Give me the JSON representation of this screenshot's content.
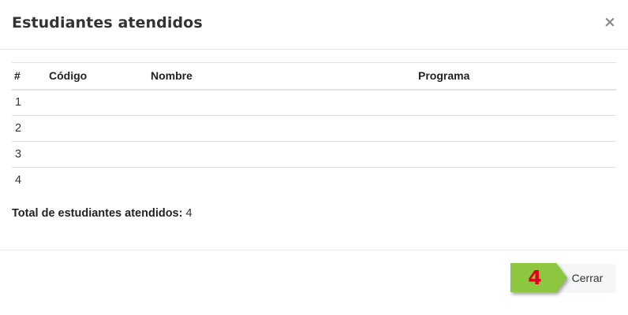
{
  "modal": {
    "title": "Estudiantes atendidos",
    "close_symbol": "×"
  },
  "table": {
    "headers": {
      "num": "#",
      "code": "Código",
      "name": "Nombre",
      "program": "Programa"
    },
    "rows": [
      {
        "num": "1",
        "code": "",
        "name": "",
        "program": ""
      },
      {
        "num": "2",
        "code": "",
        "name": "",
        "program": ""
      },
      {
        "num": "3",
        "code": "",
        "name": "",
        "program": ""
      },
      {
        "num": "4",
        "code": "",
        "name": "",
        "program": ""
      }
    ]
  },
  "summary": {
    "label": "Total de estudiantes atendidos:",
    "value": "4"
  },
  "footer": {
    "close_label": "Cerrar"
  },
  "callout": {
    "step": "4",
    "fill_color": "#8dc63f",
    "text_color": "#e3001b"
  },
  "icons": {
    "close": "close-icon",
    "callout": "step-arrow-icon"
  }
}
